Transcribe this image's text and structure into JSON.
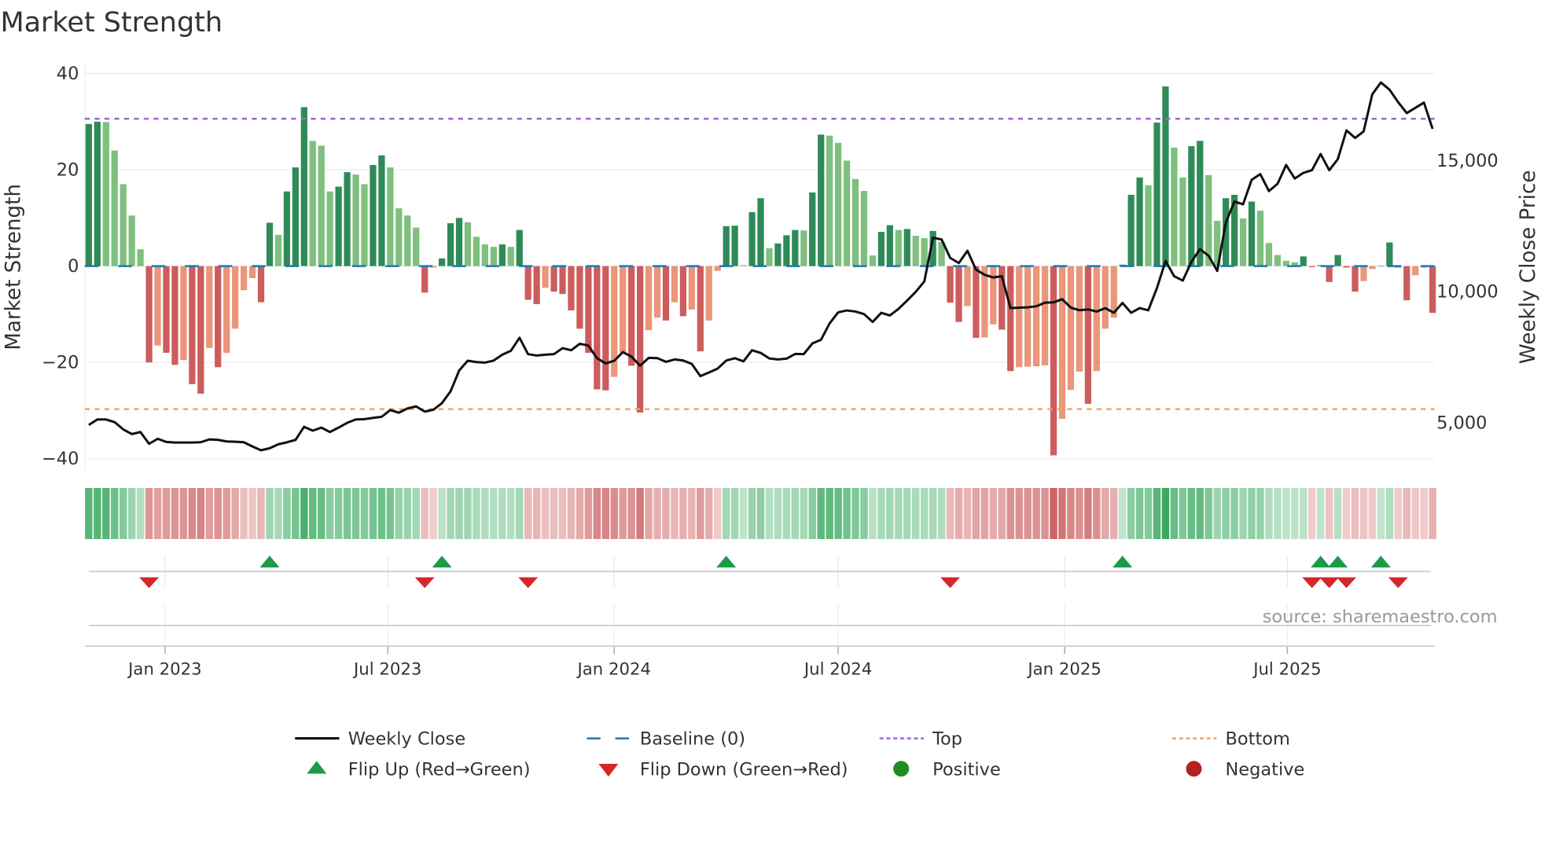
{
  "title": "Market Strength",
  "source": "source: sharemaestro.com",
  "colors": {
    "pos_strong": "#2e8b57",
    "pos_weak": "#7fbf7f",
    "neg_strong": "#cd5c5c",
    "neg_weak": "#e9967a",
    "close": "#111111",
    "baseline": "#1f77b4",
    "top": "#9966dd",
    "bottom": "#f4a460",
    "flip_up": "#1a9c47",
    "flip_down": "#d62728",
    "positive": "#228b22",
    "negative": "#b22222"
  },
  "chart_data": {
    "type": "bar",
    "title": "Market Strength",
    "xlabel": "",
    "ylabel": "Market Strength",
    "y2label": "Weekly Close Price",
    "ylim": [
      -42.2,
      42
    ],
    "y2lim": [
      3220,
      18690
    ],
    "yticks": [
      40,
      20,
      0,
      -20,
      -40
    ],
    "yticklabels": [
      "40",
      "20",
      "0",
      "−20",
      "−40"
    ],
    "y2ticks": [
      15000,
      10000,
      5000
    ],
    "y2ticklabels": [
      "15,000",
      "10,000",
      "5,000"
    ],
    "frequency": "weekly",
    "start_week": "2022-10-31",
    "xticks": [
      {
        "date": "2023-01-01",
        "label": "Jan 2023"
      },
      {
        "date": "2023-07-01",
        "label": "Jul 2023"
      },
      {
        "date": "2024-01-01",
        "label": "Jan 2024"
      },
      {
        "date": "2024-07-01",
        "label": "Jul 2024"
      },
      {
        "date": "2025-01-01",
        "label": "Jan 2025"
      },
      {
        "date": "2025-07-01",
        "label": "Jul 2025"
      }
    ],
    "top_level": 30.6,
    "bottom_level": -29.7,
    "baseline": 0,
    "strength": [
      29.5,
      30,
      29.9,
      24,
      17,
      10.5,
      3.5,
      -20,
      -16.5,
      -18,
      -20.5,
      -19.5,
      -24.5,
      -26.5,
      -17,
      -21,
      -18,
      -13,
      -5,
      -2.5,
      -7.5,
      9,
      6.5,
      15.5,
      20.5,
      33,
      26,
      25,
      15.5,
      16.5,
      19.5,
      19,
      17,
      21,
      23,
      20.5,
      12,
      10.5,
      8,
      -5.5,
      -0.3,
      1.6,
      8.9,
      10,
      9.1,
      6.1,
      4.5,
      4,
      4.5,
      4,
      7.5,
      -7,
      -7.9,
      -4.5,
      -5.3,
      -5.8,
      -9.2,
      -13,
      -18,
      -25.6,
      -25.8,
      -23,
      -18,
      -20.7,
      -30.4,
      -13.3,
      -10.7,
      -11.3,
      -7.5,
      -10.4,
      -9,
      -17.7,
      -11.3,
      -1,
      8.3,
      8.4,
      0.2,
      11.2,
      14.1,
      3.7,
      4.7,
      6.4,
      7.5,
      7.4,
      15.3,
      27.3,
      27.1,
      25.6,
      21.9,
      18.1,
      15.6,
      2.2,
      7.1,
      8.5,
      7.5,
      7.7,
      6.3,
      5.8,
      7.3,
      5,
      -7.6,
      -11.6,
      -8.3,
      -14.9,
      -14.8,
      -12.1,
      -13.2,
      -21.8,
      -21,
      -20.9,
      -20.8,
      -20.6,
      -39.3,
      -31.7,
      -25.7,
      -21.9,
      -28.6,
      -21.8,
      -13,
      -10.7,
      0.3,
      14.8,
      18.4,
      16.8,
      29.8,
      37.3,
      24.6,
      18.4,
      24.9,
      26,
      18.9,
      9.4,
      14.1,
      14.8,
      9.9,
      13.4,
      11.5,
      4.8,
      2.3,
      1.1,
      0.8,
      2,
      -0.2,
      0.2,
      -3.3,
      2.3,
      -0.3,
      -5.3,
      -3.1,
      -0.6,
      0.1,
      4.9,
      -0.3,
      -7.1,
      -1.9,
      -0.3,
      -9.7
    ],
    "weekly_close": [
      4914,
      5124,
      5124,
      5023,
      4746,
      4566,
      4645,
      4195,
      4386,
      4266,
      4244,
      4244,
      4244,
      4255,
      4364,
      4345,
      4285,
      4274,
      4255,
      4094,
      3945,
      4027,
      4176,
      4250,
      4345,
      4843,
      4694,
      4813,
      4645,
      4813,
      4994,
      5124,
      5135,
      5184,
      5225,
      5484,
      5383,
      5543,
      5622,
      5424,
      5494,
      5743,
      6193,
      6992,
      7362,
      7312,
      7292,
      7372,
      7592,
      7742,
      8241,
      7612,
      7562,
      7592,
      7612,
      7842,
      7762,
      8012,
      7942,
      7462,
      7262,
      7362,
      7692,
      7522,
      7172,
      7472,
      7462,
      7322,
      7412,
      7372,
      7242,
      6773,
      6912,
      7062,
      7372,
      7462,
      7342,
      7762,
      7662,
      7450,
      7412,
      7442,
      7622,
      7612,
      8022,
      8162,
      8791,
      9211,
      9280,
      9241,
      9141,
      8841,
      9191,
      9091,
      9340,
      9660,
      9990,
      10389,
      12057,
      11987,
      11288,
      11088,
      11558,
      10839,
      10639,
      10539,
      10589,
      9370,
      9390,
      9400,
      9440,
      9580,
      9590,
      9710,
      9390,
      9290,
      9320,
      9241,
      9370,
      9191,
      9570,
      9191,
      9370,
      9290,
      10140,
      11168,
      10589,
      10419,
      11138,
      11618,
      11368,
      10789,
      12636,
      13435,
      13335,
      14264,
      14484,
      13835,
      14114,
      14833,
      14314,
      14534,
      14634,
      15253,
      14634,
      15053,
      16152,
      15863,
      16112,
      17530,
      17980,
      17700,
      17231,
      16811,
      17011,
      17211,
      16212
    ],
    "flip_up_weeks": [
      22,
      42,
      75,
      121,
      144,
      146,
      151
    ],
    "flip_down_weeks": [
      8,
      40,
      52,
      101,
      143,
      145,
      147,
      153
    ],
    "legend_position": "bottom",
    "legend": [
      {
        "key": "close",
        "label": "Weekly Close"
      },
      {
        "key": "baseline",
        "label": "Baseline (0)"
      },
      {
        "key": "top",
        "label": "Top"
      },
      {
        "key": "bottom",
        "label": "Bottom"
      },
      {
        "key": "flip_up",
        "label": "Flip Up (Red→Green)"
      },
      {
        "key": "flip_down",
        "label": "Flip Down (Green→Red)"
      },
      {
        "key": "positive",
        "label": "Positive"
      },
      {
        "key": "negative",
        "label": "Negative"
      }
    ],
    "grid": true
  }
}
